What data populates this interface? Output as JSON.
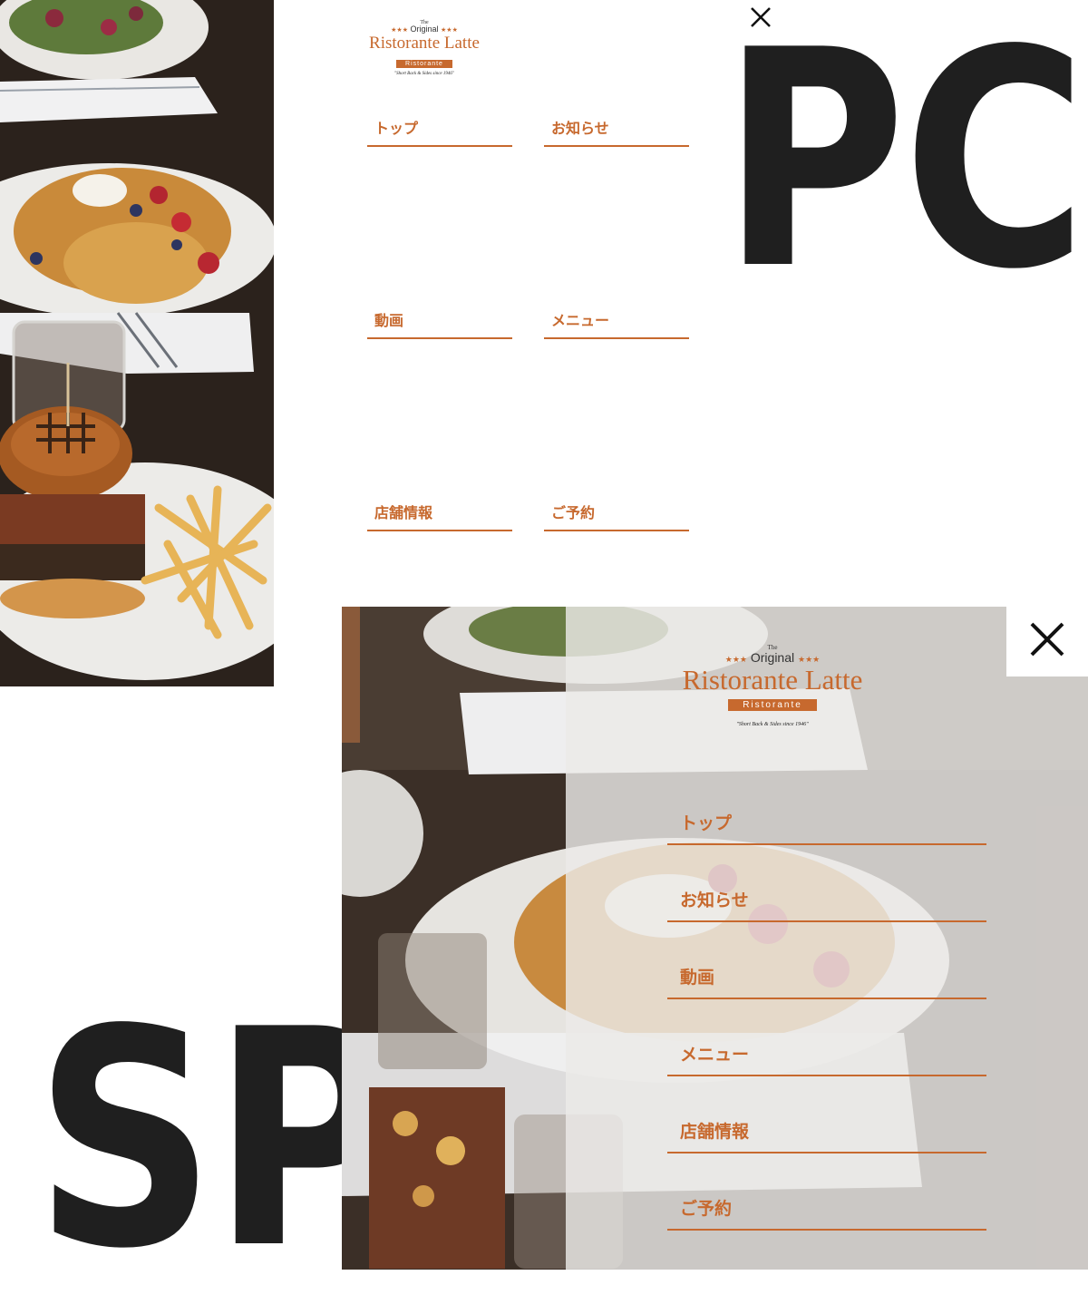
{
  "labels": {
    "pc": "PC",
    "sp": "SP"
  },
  "logo": {
    "the": "The",
    "original": "Original",
    "stars": "★★★",
    "name": "Ristorante Latte",
    "banner": "Ristorante",
    "tagline": "\"Short Back & Sides since 1946\""
  },
  "pc_menu": {
    "items": [
      "トップ",
      "お知らせ",
      "動画",
      "メニュー",
      "店舗情報",
      "ご予約"
    ]
  },
  "sp_menu": {
    "items": [
      "トップ",
      "お知らせ",
      "動画",
      "メニュー",
      "店舗情報",
      "ご予約"
    ]
  },
  "colors": {
    "accent": "#c7692e",
    "label": "#1f1f1f",
    "overlay": "#eceae8"
  },
  "icons": {
    "close": "close-icon"
  }
}
